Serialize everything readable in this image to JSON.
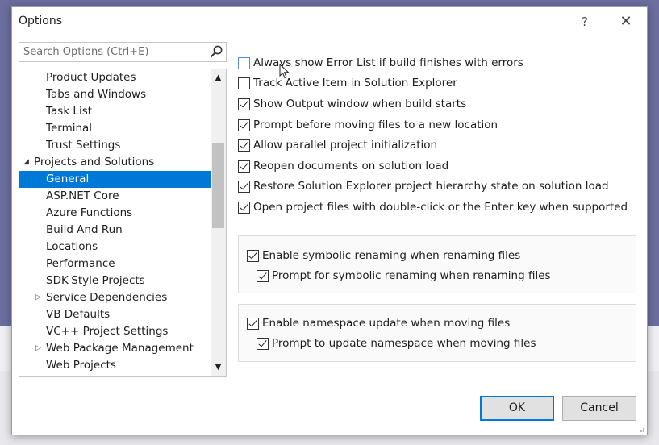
{
  "dialog": {
    "title": "Options",
    "help_label": "?",
    "close_label": "✕"
  },
  "search": {
    "placeholder": "Search Options (Ctrl+E)",
    "icon": "search-icon"
  },
  "tree": {
    "items": [
      {
        "label": "Product Updates",
        "level": 1
      },
      {
        "label": "Tabs and Windows",
        "level": 1
      },
      {
        "label": "Task List",
        "level": 1
      },
      {
        "label": "Terminal",
        "level": 1
      },
      {
        "label": "Trust Settings",
        "level": 1
      },
      {
        "label": "Projects and Solutions",
        "level": 0,
        "expanded": true
      },
      {
        "label": "General",
        "level": 1,
        "selected": true
      },
      {
        "label": "ASP.NET Core",
        "level": 1
      },
      {
        "label": "Azure Functions",
        "level": 1
      },
      {
        "label": "Build And Run",
        "level": 1
      },
      {
        "label": "Locations",
        "level": 1
      },
      {
        "label": "Performance",
        "level": 1
      },
      {
        "label": "SDK-Style Projects",
        "level": 1
      },
      {
        "label": "Service Dependencies",
        "level": 1,
        "collapsed": true
      },
      {
        "label": "VB Defaults",
        "level": 1
      },
      {
        "label": "VC++ Project Settings",
        "level": 1
      },
      {
        "label": "Web Package Management",
        "level": 1,
        "collapsed": true
      },
      {
        "label": "Web Projects",
        "level": 1
      }
    ]
  },
  "options": [
    {
      "label": "Always show Error List if build finishes with errors",
      "checked": false
    },
    {
      "label": "Track Active Item in Solution Explorer",
      "checked": false
    },
    {
      "label": "Show Output window when build starts",
      "checked": true
    },
    {
      "label": "Prompt before moving files to a new location",
      "checked": true
    },
    {
      "label": "Allow parallel project initialization",
      "checked": true
    },
    {
      "label": "Reopen documents on solution load",
      "checked": true
    },
    {
      "label": "Restore Solution Explorer project hierarchy state on solution load",
      "checked": true
    },
    {
      "label": "Open project files with double-click or the Enter key when supported",
      "checked": true
    }
  ],
  "group_rename": {
    "main": {
      "label": "Enable symbolic renaming when renaming files",
      "checked": true
    },
    "sub": {
      "label": "Prompt for symbolic renaming when renaming files",
      "checked": true
    }
  },
  "group_namespace": {
    "main": {
      "label": "Enable namespace update when moving files",
      "checked": true
    },
    "sub": {
      "label": "Prompt to update namespace when moving files",
      "checked": true
    }
  },
  "buttons": {
    "ok": "OK",
    "cancel": "Cancel"
  },
  "colors": {
    "selection": "#0078d7",
    "primary_border": "#0078d7"
  }
}
